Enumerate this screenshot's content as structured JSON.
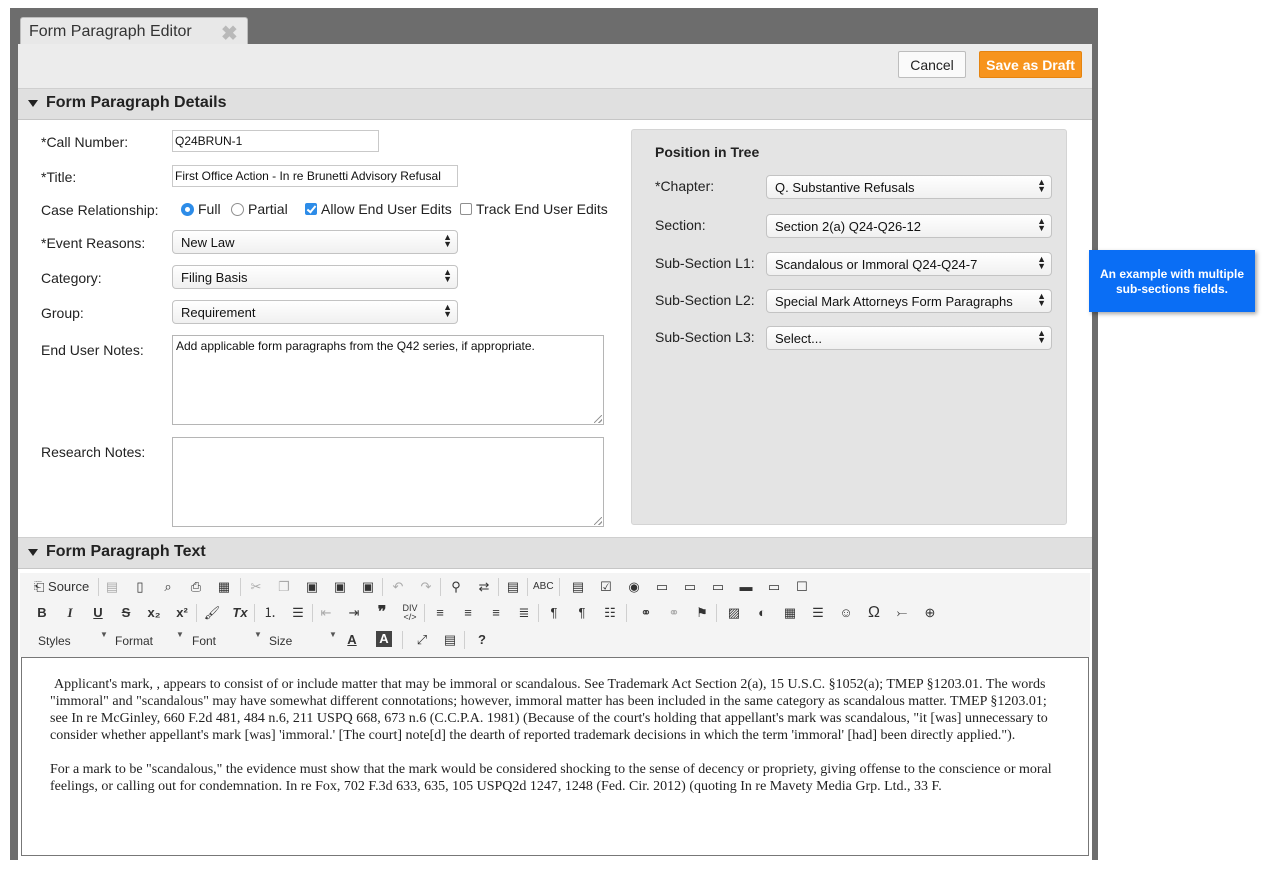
{
  "tab": {
    "title": "Form Paragraph Editor",
    "close_glyph": "✖"
  },
  "toolbar_top": {
    "cancel_label": "Cancel",
    "save_label": "Save as Draft"
  },
  "details": {
    "header": "Form Paragraph Details",
    "call_number_label": "*Call Number:",
    "call_number_value": "Q24BRUN-1",
    "title_label": "*Title:",
    "title_value": "First Office Action - In re Brunetti Advisory Refusal",
    "case_rel_label": "Case Relationship:",
    "radio_full": "Full",
    "radio_partial": "Partial",
    "allow_edits": "Allow End User Edits",
    "track_edits": "Track End User Edits",
    "event_reasons_label": "*Event Reasons:",
    "event_reasons_value": "New Law",
    "category_label": "Category:",
    "category_value": "Filing Basis",
    "group_label": "Group:",
    "group_value": "Requirement",
    "end_user_notes_label": "End User Notes:",
    "end_user_notes_value": "Add applicable form paragraphs from the Q42 series, if appropriate.",
    "research_notes_label": "Research Notes:",
    "research_notes_value": ""
  },
  "tree": {
    "title": "Position in Tree",
    "chapter_label": "*Chapter:",
    "chapter_value": "Q. Substantive Refusals",
    "section_label": "Section:",
    "section_value": "Section 2(a) Q24-Q26-12",
    "sub1_label": "Sub-Section L1:",
    "sub1_value": "Scandalous or Immoral Q24-Q24-7",
    "sub2_label": "Sub-Section L2:",
    "sub2_value": "Special Mark Attorneys Form Paragraphs",
    "sub3_label": "Sub-Section L3:",
    "sub3_value": "Select..."
  },
  "callout": {
    "text": "An example with multiple sub-sections fields."
  },
  "text_section": {
    "header": "Form Paragraph Text"
  },
  "editor_toolbar": {
    "source_label": "Source",
    "styles_label": "Styles",
    "format_label": "Format",
    "font_label": "Font",
    "size_label": "Size",
    "bold": "B",
    "italic": "I",
    "underline": "U",
    "strike": "S",
    "subscript": "x₂",
    "superscript": "x²",
    "remove_format": "Tx",
    "blockquote": "❞",
    "help": "?",
    "omega": "Ω"
  },
  "editor": {
    "para1": "Applicant's mark, , appears to consist of or include matter that may be immoral or scandalous. See Trademark Act Section 2(a), 15 U.S.C. §1052(a); TMEP §1203.01. The words \"immoral\" and \"scandalous\" may have somewhat different connotations; however, immoral matter has been included in the same category as scandalous matter. TMEP §1203.01; see In re McGinley, 660 F.2d 481, 484 n.6, 211 USPQ 668, 673 n.6 (C.C.P.A. 1981) (Because of the court's holding that appellant's mark was scandalous, \"it [was] unnecessary to consider whether appellant's mark [was] 'immoral.' [The court] note[d] the dearth of reported trademark decisions in which the term 'immoral' [had] been directly applied.\").",
    "para2": "For a mark to be \"scandalous,\" the evidence must show that the mark would be considered shocking to the sense of decency or propriety, giving offense to the conscience or moral feelings, or calling out for condemnation. In re Fox, 702 F.3d 633, 635, 105 USPQ2d 1247, 1248 (Fed. Cir. 2012) (quoting In re Mavety Media Grp. Ltd., 33 F."
  },
  "colors": {
    "accent": "#f7941d",
    "callout": "#0a6ef5",
    "selected": "#2d8ce8"
  }
}
